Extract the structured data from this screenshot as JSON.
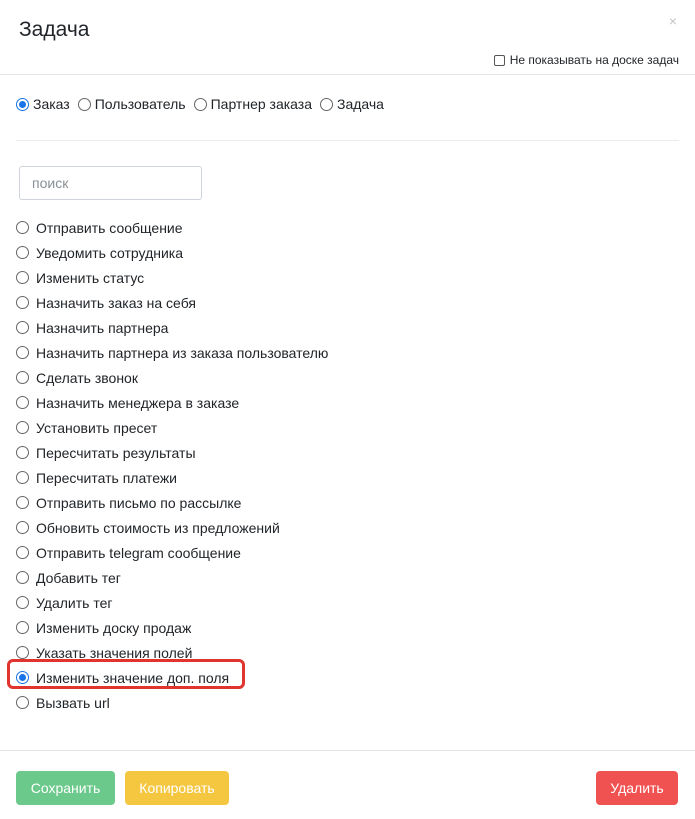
{
  "modal": {
    "title": "Задача",
    "close_symbol": "×",
    "hide_on_board_label": "Не показывать на доске задач"
  },
  "types": [
    {
      "label": "Заказ",
      "checked": true
    },
    {
      "label": "Пользователь",
      "checked": false
    },
    {
      "label": "Партнер заказа",
      "checked": false
    },
    {
      "label": "Задача",
      "checked": false
    }
  ],
  "search": {
    "placeholder": "поиск",
    "value": ""
  },
  "actions": [
    {
      "label": "Отправить сообщение",
      "checked": false
    },
    {
      "label": "Уведомить сотрудника",
      "checked": false
    },
    {
      "label": "Изменить статус",
      "checked": false
    },
    {
      "label": "Назначить заказ на себя",
      "checked": false
    },
    {
      "label": "Назначить партнера",
      "checked": false
    },
    {
      "label": "Назначить партнера из заказа пользователю",
      "checked": false
    },
    {
      "label": "Сделать звонок",
      "checked": false
    },
    {
      "label": "Назначить менеджера в заказе",
      "checked": false
    },
    {
      "label": "Установить пресет",
      "checked": false
    },
    {
      "label": "Пересчитать результаты",
      "checked": false
    },
    {
      "label": "Пересчитать платежи",
      "checked": false
    },
    {
      "label": "Отправить письмо по рассылке",
      "checked": false
    },
    {
      "label": "Обновить стоимость из предложений",
      "checked": false
    },
    {
      "label": "Отправить telegram сообщение",
      "checked": false
    },
    {
      "label": "Добавить тег",
      "checked": false
    },
    {
      "label": "Удалить тег",
      "checked": false
    },
    {
      "label": "Изменить доску продаж",
      "checked": false
    },
    {
      "label": "Указать значения полей",
      "checked": false
    },
    {
      "label": "Изменить значение доп. поля",
      "checked": true
    },
    {
      "label": "Вызвать url",
      "checked": false
    }
  ],
  "footer": {
    "save_label": "Сохранить",
    "copy_label": "Копировать",
    "delete_label": "Удалить"
  },
  "colors": {
    "save": "#6bc98b",
    "copy": "#f5c741",
    "delete": "#f05252",
    "highlight": "#e0342c",
    "radio_accent": "#1a73e8"
  }
}
